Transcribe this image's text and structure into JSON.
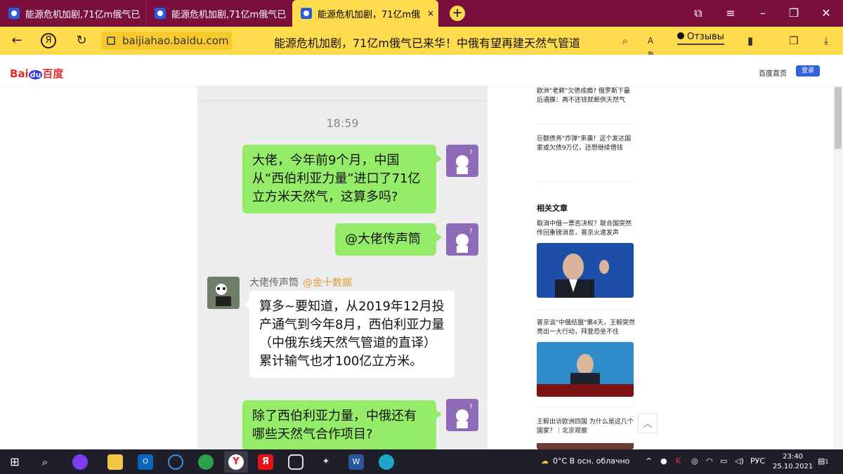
{
  "browser": {
    "tabs": [
      {
        "label": "能源危机加剧,71亿m俄气已",
        "active": false
      },
      {
        "label": "能源危机加剧,71亿m俄气已",
        "active": false
      },
      {
        "label": "能源危机加剧，71亿m俄",
        "active": true,
        "close": "×"
      }
    ],
    "new_tab": "+",
    "url": "baijiahao.baidu.com",
    "page_title": "能源危机加剧，71亿m俄气已来华！中俄有望再建天然气管道",
    "reviews_label": "Отзывы",
    "icons": [
      "back-icon",
      "yandex-icon",
      "reload-icon",
      "lock-icon",
      "search-icon",
      "translate-icon",
      "bookmark-icon",
      "collections-icon",
      "download-icon",
      "window-minimize-icon",
      "window-maximize-icon",
      "window-close-icon",
      "menu-icon",
      "bookmarks-panel-icon"
    ]
  },
  "site": {
    "logo": "Bai",
    "logo_du": "du",
    "logo_cn": "百度",
    "home_link": "百度首页",
    "login_label": "登录"
  },
  "chat": {
    "time": "18:59",
    "msg1": "大佬，今年前9个月，中国从“西伯利亚力量”进口了71亿立方米天然气，这算多吗?",
    "msg2": "@大佬传声筒",
    "sender_name": "大佬传声筒",
    "sender_tag": "@金十数据",
    "reply": "算多~要知道，从2019年12月投产通气到今年8月，西伯利亚力量（中俄东线天然气管道的直译）累计输气也才100亿立方米。",
    "msg3": "除了西伯利亚力量，中俄还有哪些天然气合作项目?"
  },
  "sidebar": {
    "item1": "欧洲\"老赖\"欠债成瘾? 俄罗斯下最后通牒：再不还钱就断供天然气",
    "item2": "巨额债务\"炸弹\"来袭！这个发达国家或欠债9万亿，还想继续借钱",
    "related_heading": "相关文章",
    "article1": "取消中俄一票否决权？联合国突然传回重磅消息，普京火速发声",
    "article2": "普京谈\"中俄结盟\"第4天，王毅突然亮出一大行动，拜登恐坐不住",
    "article3": "王毅出访欧洲四国 为什么是这几个国家？｜北京观察",
    "scroll_top": "︿"
  },
  "taskbar": {
    "weather": "0°C  В осн. облачно",
    "lang": "РУС",
    "time": "23:40",
    "date": "25.10.2021",
    "notif_count": "1"
  },
  "colors": {
    "tab_bar": "#7a0e3c",
    "accent_yellow": "#ffdb4d",
    "wechat_green": "#95ec69",
    "baidu_blue": "#2932e1",
    "baidu_red": "#e12c2c",
    "taskbar": "#1f1f2b"
  }
}
